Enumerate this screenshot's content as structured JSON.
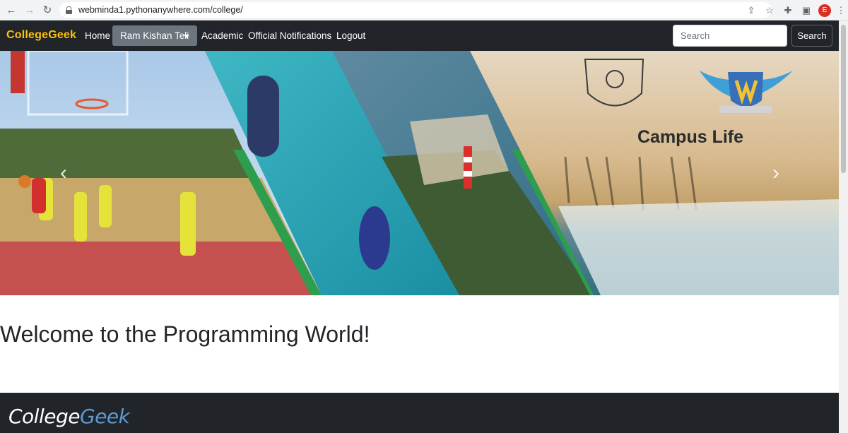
{
  "browser": {
    "url": "webminda1.pythonanywhere.com/college/",
    "back_icon": "←",
    "forward_icon": "→",
    "reload_icon": "↻",
    "share_icon": "⇪",
    "star_icon": "☆",
    "extensions_icon": "✚",
    "sidepanel_icon": "▣",
    "menu_icon": "⋮",
    "profile_initial": "E",
    "profile_color": "#d93025"
  },
  "navbar": {
    "brand": "CollegeGeek",
    "brand_color": "#ffc107",
    "links": {
      "home": "Home",
      "user": "Ram Kishan Teli",
      "academic": "Academic",
      "notifications": "Official Notifications",
      "logout": "Logout"
    },
    "search_placeholder": "Search",
    "search_button": "Search"
  },
  "carousel": {
    "caption": "Campus Life",
    "prev_icon": "‹",
    "next_icon": "›"
  },
  "main": {
    "heading": "Welcome to the Programming World!"
  },
  "footer": {
    "brand_part1": "College",
    "brand_part2": "Geek",
    "accent_color": "#5b9bd5"
  }
}
